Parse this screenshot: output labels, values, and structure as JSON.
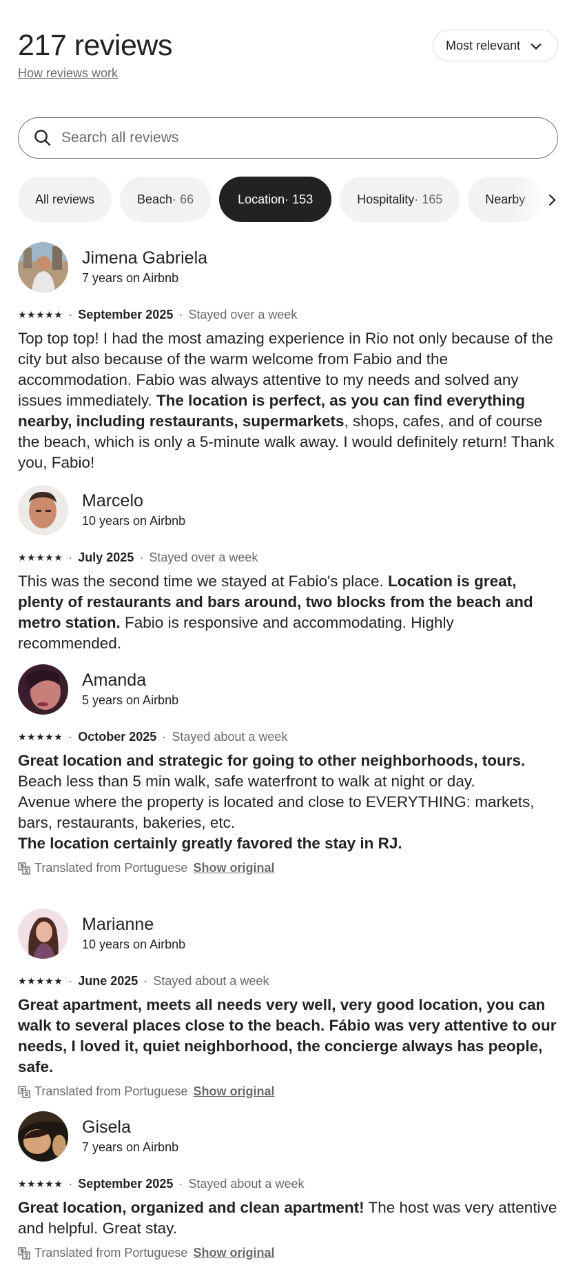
{
  "header": {
    "title": "217 reviews",
    "how_link": "How reviews work",
    "sort_label": "Most relevant",
    "sort_icon": "chevron-down-icon"
  },
  "search": {
    "placeholder": "Search all reviews",
    "value": "",
    "icon": "search-icon"
  },
  "filters": {
    "chips": [
      {
        "label": "All reviews",
        "count": ""
      },
      {
        "label": "Beach",
        "count": " · 66"
      },
      {
        "label": "Location",
        "count": " · 153",
        "active": true
      },
      {
        "label": "Hospitality",
        "count": " · 165"
      },
      {
        "label": "Nearby",
        "count": ""
      }
    ],
    "next_icon": "chevron-right-icon"
  },
  "reviews": [
    {
      "name": "Jimena Gabriela",
      "tenure": "7 years on Airbnb",
      "rating": "★★★★★",
      "date": "September 2025",
      "stay": "Stayed over a week",
      "segments": [
        {
          "t": "Top top top! I had the most amazing experience in Rio not only because of the city but also because of the warm welcome from Fabio and the accommodation. Fabio was always attentive to my needs and solved any issues immediately. "
        },
        {
          "t": "The location is perfect, as you can find everything nearby, including restaurants, supermarkets",
          "bold": true
        },
        {
          "t": ", shops, cafes, and of course the beach, which is only a 5-minute walk away. I would definitely return! Thank you, Fabio!"
        }
      ]
    },
    {
      "name": "Marcelo",
      "tenure": "10 years on Airbnb",
      "rating": "★★★★★",
      "date": "July 2025",
      "stay": "Stayed over a week",
      "segments": [
        {
          "t": "This was the second time we stayed at Fabio's place. "
        },
        {
          "t": "Location is great, plenty of restaurants and bars around, two blocks from the beach and metro station.",
          "bold": true
        },
        {
          "t": " Fabio is responsive and accommodating. Highly recommended."
        }
      ]
    },
    {
      "name": "Amanda",
      "tenure": "5 years on Airbnb",
      "rating": "★★★★★",
      "date": "October 2025",
      "stay": "Stayed about a week",
      "segments": [
        {
          "t": "Great location and strategic for going to other neighborhoods, tours.",
          "bold": true
        },
        {
          "t": " Beach less than 5 min walk, safe waterfront to walk at night or day."
        },
        {
          "br": true
        },
        {
          "t": "Avenue where the property is located and close to EVERYTHING: markets, bars, restaurants, bakeries, etc."
        },
        {
          "br": true
        },
        {
          "t": "The location certainly greatly favored the stay in RJ.",
          "bold": true
        }
      ],
      "translated": "Translated from Portuguese",
      "show_original": "Show original"
    },
    {
      "name": "Marianne",
      "tenure": "10 years on Airbnb",
      "rating": "★★★★★",
      "date": "June 2025",
      "stay": "Stayed about a week",
      "segments": [
        {
          "t": "Great apartment, meets all needs very well, very good location, you can walk to several places close to the beach. Fábio was very attentive to our needs, I loved it, quiet neighborhood, the concierge always has people, safe.",
          "bold": true
        }
      ],
      "translated": "Translated from Portuguese",
      "show_original": "Show original"
    },
    {
      "name": "Gisela",
      "tenure": "7 years on Airbnb",
      "rating": "★★★★★",
      "date": "September 2025",
      "stay": "Stayed about a week",
      "segments": [
        {
          "t": "Great location, organized and clean apartment!",
          "bold": true
        },
        {
          "t": " The host was very attentive and helpful. Great stay."
        }
      ],
      "translated": "Translated from Portuguese",
      "show_original": "Show original"
    }
  ]
}
